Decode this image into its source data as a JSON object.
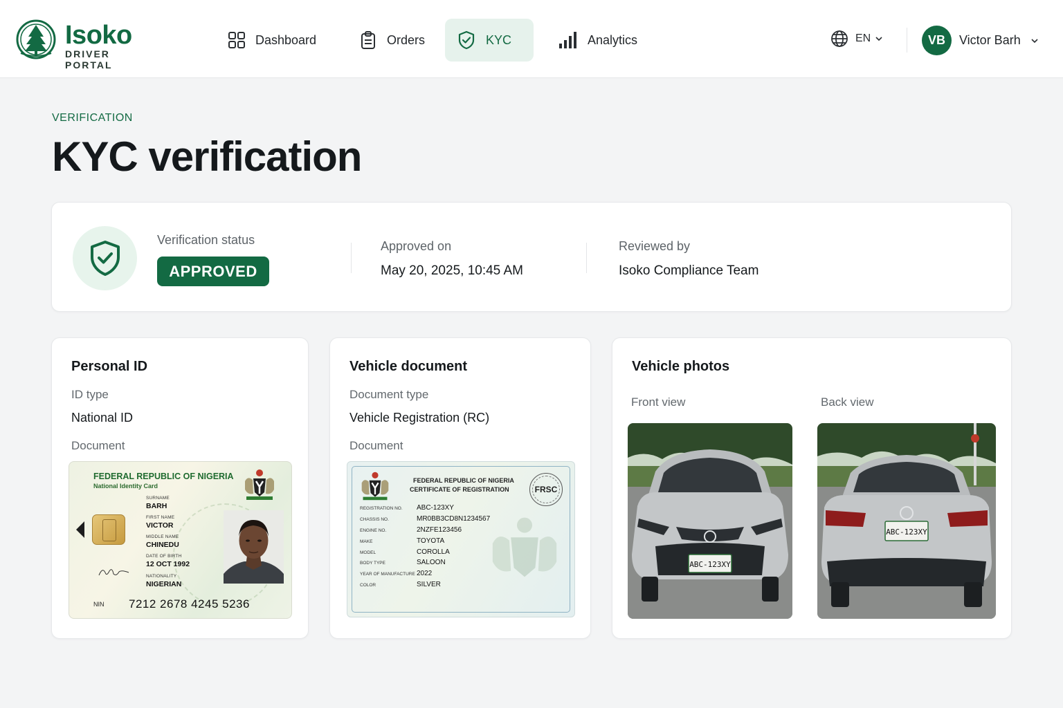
{
  "brand": {
    "name": "Isoko",
    "subtitle": "DRIVER PORTAL"
  },
  "nav": [
    {
      "label": "Dashboard",
      "icon": "grid-icon",
      "active": false
    },
    {
      "label": "Orders",
      "icon": "clipboard-icon",
      "active": false
    },
    {
      "label": "KYC",
      "icon": "shield-check-icon",
      "active": true
    },
    {
      "label": "Analytics",
      "icon": "bar-chart-icon",
      "active": false
    }
  ],
  "language": {
    "value": "EN",
    "icon": "globe-icon"
  },
  "user": {
    "initials": "VB",
    "name": "Victor Barh"
  },
  "page": {
    "eyebrow": "VERIFICATION",
    "title": "KYC verification"
  },
  "status": {
    "label": "Verification status",
    "value": "APPROVED",
    "approved_label": "Approved on",
    "approved_value": "May 20, 2025, 10:45 AM",
    "reviewed_label": "Reviewed by",
    "reviewed_value": "Isoko Compliance Team",
    "accent": "#136a43"
  },
  "personal_id": {
    "title": "Personal ID",
    "id_type_label": "ID type",
    "id_type_value": "National ID",
    "document_label": "Document",
    "card": {
      "header": "FEDERAL REPUBLIC OF NIGERIA",
      "subheader": "National Identity Card",
      "surname_label": "SURNAME",
      "surname": "BARH",
      "first_name_label": "FIRST NAME",
      "first_name": "VICTOR",
      "middle_name_label": "MIDDLE NAME",
      "middle_name": "CHINEDU",
      "dob_label": "DATE OF BIRTH",
      "dob": "12 OCT 1992",
      "nationality_label": "NATIONALITY",
      "nationality": "NIGERIAN",
      "nin_label": "NIN",
      "nin": "7212 2678 4245 5236"
    }
  },
  "vehicle_document": {
    "title": "Vehicle document",
    "doc_type_label": "Document type",
    "doc_type_value": "Vehicle Registration (RC)",
    "document_label": "Document",
    "card": {
      "header1": "FEDERAL REPUBLIC OF NIGERIA",
      "header2": "CERTIFICATE OF REGISTRATION",
      "seal": "FRSC",
      "rows": [
        {
          "label": "REGISTRATION NO.",
          "value": "ABC-123XY"
        },
        {
          "label": "CHASSIS NO.",
          "value": "MR0BB3CD8N1234567"
        },
        {
          "label": "ENGINE NO.",
          "value": "2NZFE123456"
        },
        {
          "label": "MAKE",
          "value": "TOYOTA"
        },
        {
          "label": "MODEL",
          "value": "COROLLA"
        },
        {
          "label": "BODY TYPE",
          "value": "SALOON"
        },
        {
          "label": "YEAR OF MANUFACTURE",
          "value": "2022"
        },
        {
          "label": "COLOR",
          "value": "SILVER"
        }
      ]
    }
  },
  "vehicle_photos": {
    "title": "Vehicle photos",
    "front_label": "Front view",
    "back_label": "Back view",
    "plate": "ABC-123XY"
  }
}
